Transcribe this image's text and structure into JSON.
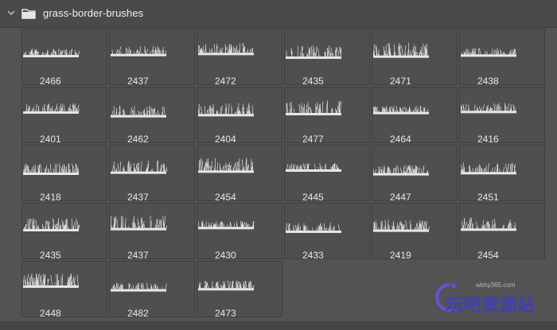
{
  "panel": {
    "group_name": "grass-border-brushes",
    "expanded": true
  },
  "icons": {
    "expand": "chevron-down-icon",
    "folder": "folder-icon"
  },
  "brushes": [
    {
      "size": "2466"
    },
    {
      "size": "2437"
    },
    {
      "size": "2472"
    },
    {
      "size": "2435"
    },
    {
      "size": "2471"
    },
    {
      "size": "2438"
    },
    {
      "size": "2401"
    },
    {
      "size": "2462"
    },
    {
      "size": "2404"
    },
    {
      "size": "2477"
    },
    {
      "size": "2464"
    },
    {
      "size": "2416"
    },
    {
      "size": "2418"
    },
    {
      "size": "2437"
    },
    {
      "size": "2454"
    },
    {
      "size": "2445"
    },
    {
      "size": "2447"
    },
    {
      "size": "2451"
    },
    {
      "size": "2435"
    },
    {
      "size": "2437"
    },
    {
      "size": "2430"
    },
    {
      "size": "2433"
    },
    {
      "size": "2419"
    },
    {
      "size": "2454"
    },
    {
      "size": "2448"
    },
    {
      "size": "2482"
    },
    {
      "size": "2473"
    }
  ],
  "watermark": {
    "url": "wbhy365.com",
    "text": "玩吧资源站"
  }
}
